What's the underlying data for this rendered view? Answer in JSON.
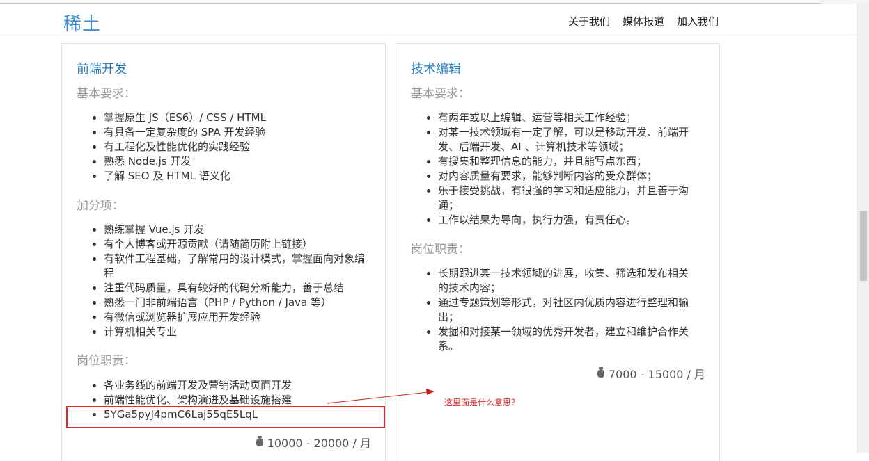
{
  "header": {
    "logo": "稀土",
    "nav": [
      "关于我们",
      "媒体报道",
      "加入我们"
    ]
  },
  "jobs": [
    {
      "title": "前端开发",
      "sections": [
        {
          "heading": "基本要求：",
          "items": [
            "掌握原生 JS（ES6）/ CSS / HTML",
            "有具备一定复杂度的 SPA 开发经验",
            "有工程化及性能优化的实践经验",
            "熟悉 Node.js 开发",
            "了解 SEO 及 HTML 语义化"
          ]
        },
        {
          "heading": "加分项：",
          "items": [
            "熟练掌握 Vue.js 开发",
            "有个人博客或开源贡献（请随简历附上链接）",
            "有软件工程基础，了解常用的设计模式，掌握面向对象编程",
            "注重代码质量，具有较好的代码分析能力，善于总结",
            "熟悉一门非前端语言（PHP / Python / Java 等）",
            "有微信或浏览器扩展应用开发经验",
            "计算机相关专业"
          ]
        },
        {
          "heading": "岗位职责：",
          "items": [
            "各业务线的前端开发及营销活动页面开发",
            "前端性能优化、架构演进及基础设施搭建",
            "5YGa5pyJ4pmC6Laj55qE5LqL"
          ]
        }
      ],
      "salary": "10000 - 20000 / 月"
    },
    {
      "title": "技术编辑",
      "sections": [
        {
          "heading": "基本要求：",
          "items": [
            "有两年或以上编辑、运营等相关工作经验；",
            "对某一技术领域有一定了解，可以是移动开发、前端开发、后端开发、AI 、计算机技术等领域；",
            "有搜集和整理信息的能力，并且能写点东西；",
            "对内容质量有要求，能够判断内容的受众群体；",
            "乐于接受挑战，有很强的学习和适应能力，并且善于沟通；",
            "工作以结果为导向，执行力强，有责任心。"
          ]
        },
        {
          "heading": "岗位职责：",
          "items": [
            "长期跟进某一技术领域的进展，收集、筛选和发布相关的技术内容；",
            "通过专题策划等形式，对社区内优质内容进行整理和输出；",
            "发掘和对接某一领域的优秀开发者，建立和维护合作关系。"
          ]
        }
      ],
      "salary": "7000 - 15000 / 月"
    }
  ],
  "annotation": {
    "note": "这里面是什么意思？",
    "color": "#d0211c"
  }
}
